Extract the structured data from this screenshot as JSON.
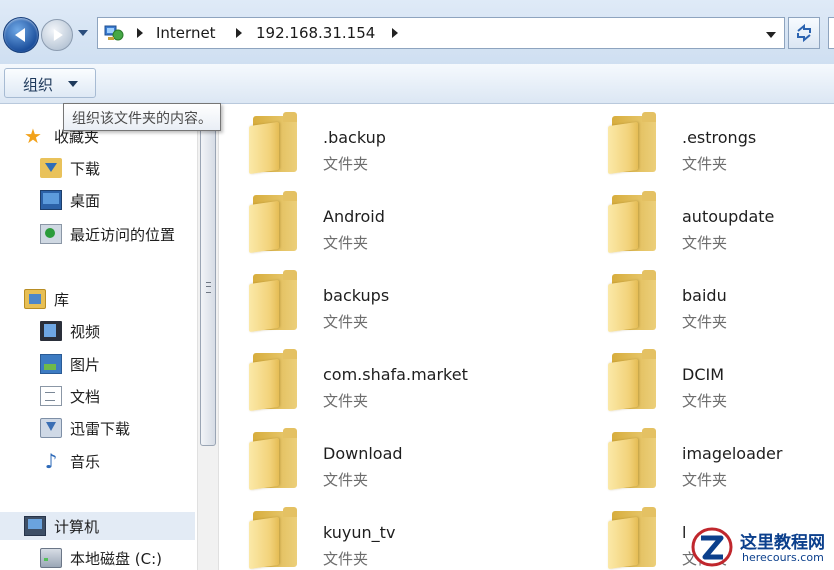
{
  "address_bar": {
    "breadcrumbs": [
      "Internet",
      "192.168.31.154"
    ],
    "icons": {
      "location": "network-icon",
      "refresh": "refresh-icon"
    }
  },
  "toolbar": {
    "organize_label": "组织"
  },
  "tooltip": {
    "text": "组织该文件夹的内容。"
  },
  "sidebar": {
    "items": [
      {
        "label": "收藏夹",
        "icon": "favorites-star-icon"
      },
      {
        "label": "下载",
        "icon": "downloads-icon"
      },
      {
        "label": "桌面",
        "icon": "desktop-icon"
      },
      {
        "label": "最近访问的位置",
        "icon": "recent-places-icon"
      },
      {
        "label": "库",
        "icon": "libraries-icon"
      },
      {
        "label": "视频",
        "icon": "videos-icon"
      },
      {
        "label": "图片",
        "icon": "pictures-icon"
      },
      {
        "label": "文档",
        "icon": "documents-icon"
      },
      {
        "label": "迅雷下载",
        "icon": "xunlei-download-icon"
      },
      {
        "label": "音乐",
        "icon": "music-icon"
      },
      {
        "label": "计算机",
        "icon": "computer-icon"
      },
      {
        "label": "本地磁盘 (C:)",
        "icon": "local-disk-icon"
      }
    ]
  },
  "folders": [
    {
      "name": ".backup",
      "type": "文件夹"
    },
    {
      "name": ".estrongs",
      "type": "文件夹"
    },
    {
      "name": "Android",
      "type": "文件夹"
    },
    {
      "name": "autoupdate",
      "type": "文件夹"
    },
    {
      "name": "backups",
      "type": "文件夹"
    },
    {
      "name": "baidu",
      "type": "文件夹"
    },
    {
      "name": "com.shafa.market",
      "type": "文件夹"
    },
    {
      "name": "DCIM",
      "type": "文件夹"
    },
    {
      "name": "Download",
      "type": "文件夹"
    },
    {
      "name": "imageloader",
      "type": "文件夹"
    },
    {
      "name": "kuyun_tv",
      "type": "文件夹"
    },
    {
      "name": "l",
      "type": "文件夹"
    }
  ],
  "watermark": {
    "title": "这里教程网",
    "url": "herecours.com"
  },
  "colors": {
    "accent": "#2c62a8",
    "folder": "#f2d27a",
    "watermark": "#0b3f8c"
  }
}
